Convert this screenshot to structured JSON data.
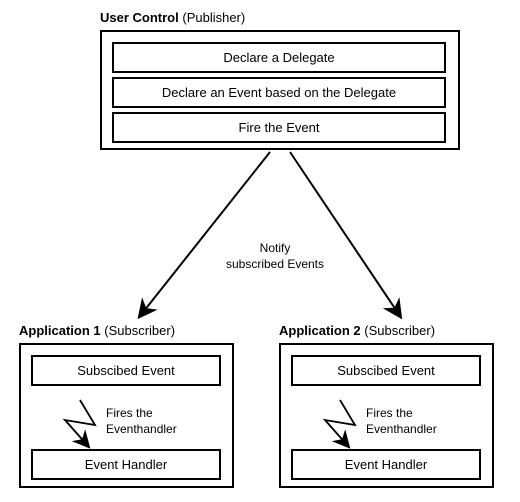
{
  "chart_data": {
    "type": "flow-diagram",
    "nodes": [
      {
        "id": "publisher",
        "label": "User Control",
        "role": "Publisher",
        "steps": [
          "Declare a Delegate",
          "Declare an Event based on the Delegate",
          "Fire the Event"
        ]
      },
      {
        "id": "sub1",
        "label": "Application 1",
        "role": "Subscriber",
        "steps": [
          "Subscibed Event",
          "Event Handler"
        ]
      },
      {
        "id": "sub2",
        "label": "Application 2",
        "role": "Subscriber",
        "steps": [
          "Subscibed Event",
          "Event Handler"
        ]
      }
    ],
    "edges": [
      {
        "from": "publisher",
        "to": "sub1",
        "label": "Notify subscribed Events"
      },
      {
        "from": "publisher",
        "to": "sub2",
        "label": "Notify subscribed Events"
      },
      {
        "from": "sub1.step0",
        "to": "sub1.step1",
        "label": "Fires the Eventhandler"
      },
      {
        "from": "sub2.step0",
        "to": "sub2.step1",
        "label": "Fires the Eventhandler"
      }
    ]
  },
  "publisher": {
    "name": "User Control",
    "role": "(Publisher)",
    "step1": "Declare a Delegate",
    "step2": "Declare an Event based on the Delegate",
    "step3": "Fire the Event"
  },
  "arrow_label": {
    "line1": "Notify",
    "line2": "subscribed Events"
  },
  "sub1": {
    "name": "Application 1",
    "role": "(Subscriber)",
    "box1": "Subscibed Event",
    "box2": "Event Handler",
    "fire": {
      "line1": "Fires the",
      "line2": "Eventhandler"
    }
  },
  "sub2": {
    "name": "Application 2",
    "role": "(Subscriber)",
    "box1": "Subscibed Event",
    "box2": "Event Handler",
    "fire": {
      "line1": "Fires the",
      "line2": "Eventhandler"
    }
  }
}
